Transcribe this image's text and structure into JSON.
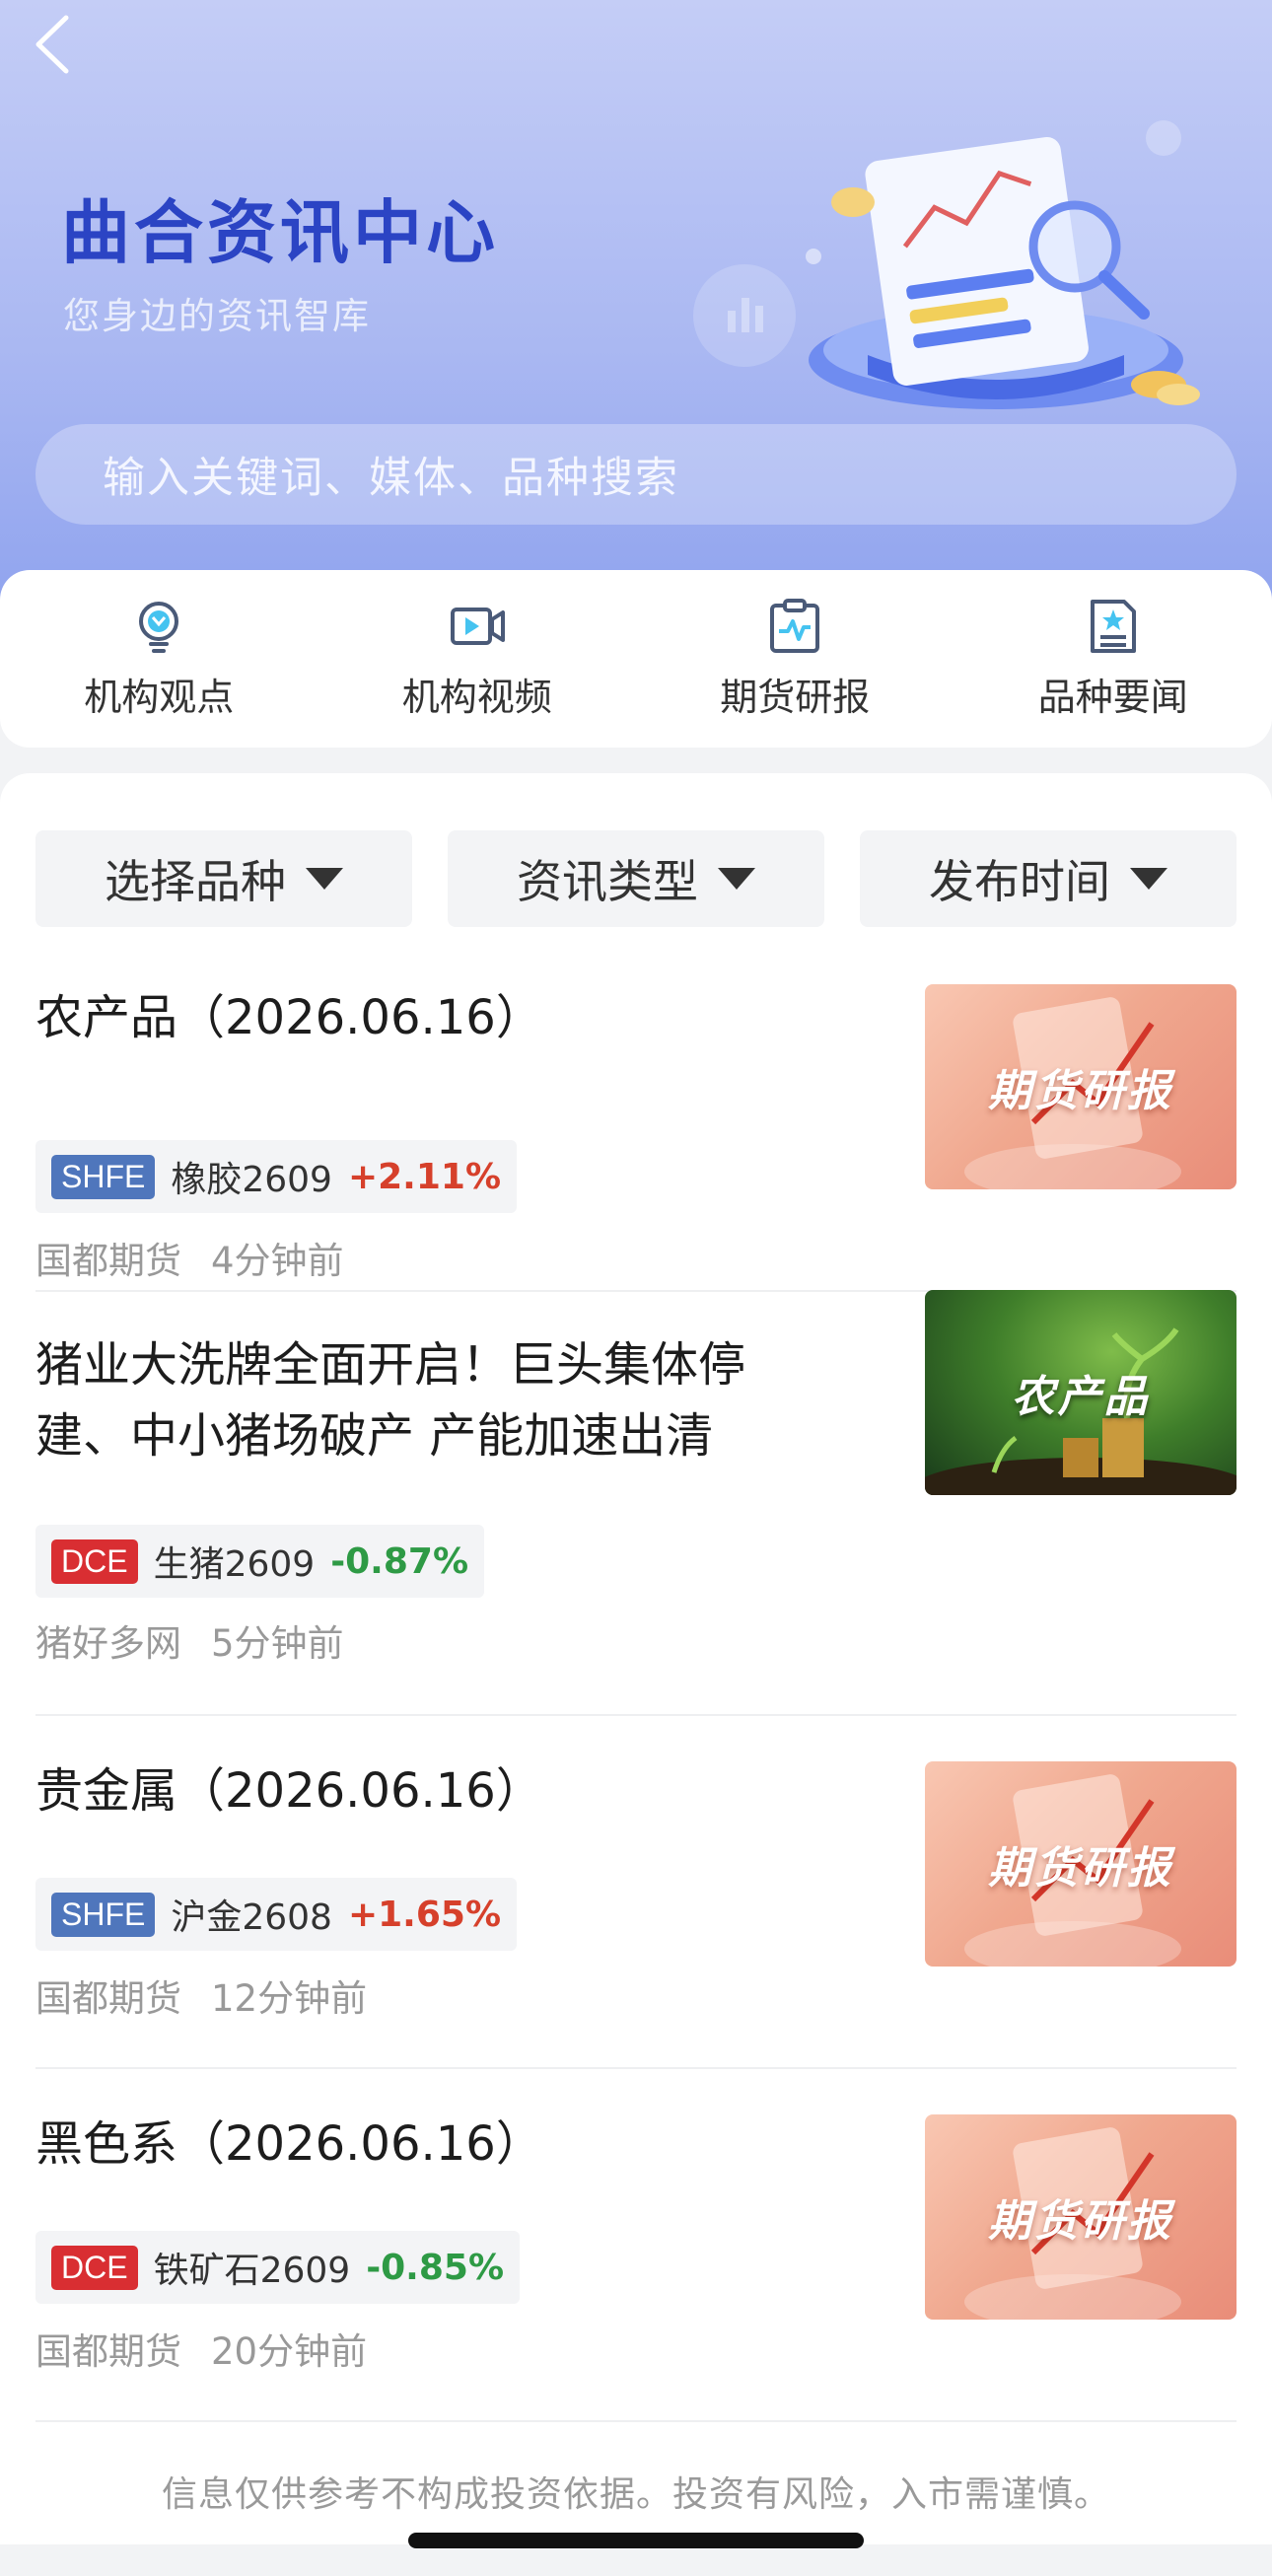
{
  "header": {
    "back_icon": "chevron-left-icon",
    "title": "曲合资讯中心",
    "subtitle": "您身边的资讯智库"
  },
  "search": {
    "placeholder": "输入关键词、媒体、品种搜索"
  },
  "categories": [
    {
      "label": "机构观点",
      "icon": "lightbulb-icon"
    },
    {
      "label": "机构视频",
      "icon": "video-icon"
    },
    {
      "label": "期货研报",
      "icon": "clipboard-chart-icon"
    },
    {
      "label": "品种要闻",
      "icon": "star-document-icon"
    }
  ],
  "filters": [
    {
      "label": "选择品种"
    },
    {
      "label": "资讯类型"
    },
    {
      "label": "发布时间"
    }
  ],
  "articles": [
    {
      "title": "农产品（2026.06.16）",
      "exchange": "SHFE",
      "contract": "橡胶2609",
      "change": "+2.11%",
      "source": "国都期货",
      "time": "4分钟前",
      "thumb_label": "期货研报"
    },
    {
      "title": "猪业大洗牌全面开启！巨头集体停建、中小猪场破产 产能加速出清",
      "exchange": "DCE",
      "contract": "生猪2609",
      "change": "-0.87%",
      "source": "猪好多网",
      "time": "5分钟前",
      "thumb_label": "农产品"
    },
    {
      "title": "贵金属（2026.06.16）",
      "exchange": "SHFE",
      "contract": "沪金2608",
      "change": "+1.65%",
      "source": "国都期货",
      "time": "12分钟前",
      "thumb_label": "期货研报"
    },
    {
      "title": "黑色系（2026.06.16）",
      "exchange": "DCE",
      "contract": "铁矿石2609",
      "change": "-0.85%",
      "source": "国都期货",
      "time": "20分钟前",
      "thumb_label": "期货研报"
    }
  ],
  "disclaimer": "信息仅供参考不构成投资依据。投资有风险，入市需谨慎。",
  "colors": {
    "title_blue": "#2b44c4",
    "up_red": "#d6402b",
    "down_green": "#2e9a45",
    "shfe_blue": "#4f76bc",
    "dce_red": "#d92e32"
  }
}
